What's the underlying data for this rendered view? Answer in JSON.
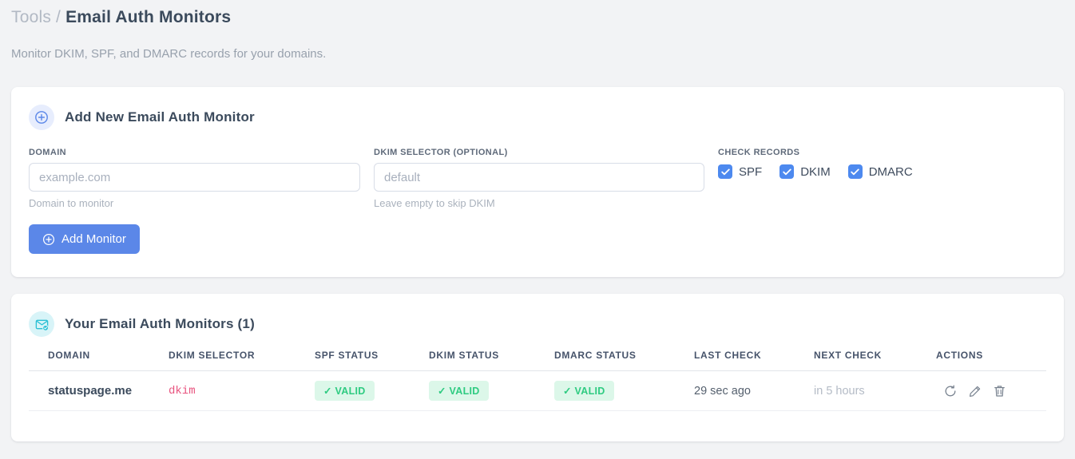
{
  "page": {
    "breadcrumb": {
      "section": "Tools",
      "separator": "/",
      "current": "Email Auth Monitors"
    },
    "subtitle": "Monitor DKIM, SPF, and DMARC records for your domains."
  },
  "add_monitor_card": {
    "title": "Add New Email Auth Monitor",
    "icon": "circle-plus-icon",
    "fields": {
      "domain": {
        "label": "DOMAIN",
        "placeholder": "example.com",
        "value": "",
        "helper": "Domain to monitor"
      },
      "dkim_selector": {
        "label": "DKIM SELECTOR (OPTIONAL)",
        "placeholder": "default",
        "value": "",
        "helper": "Leave empty to skip DKIM"
      }
    },
    "check_records": {
      "label": "CHECK RECORDS",
      "options": [
        {
          "label": "SPF",
          "checked": true
        },
        {
          "label": "DKIM",
          "checked": true
        },
        {
          "label": "DMARC",
          "checked": true
        }
      ]
    },
    "submit_label": "Add Monitor"
  },
  "monitors_card": {
    "title": "Your Email Auth Monitors (1)",
    "icon": "mail-check-icon",
    "table": {
      "columns": [
        "DOMAIN",
        "DKIM SELECTOR",
        "SPF STATUS",
        "DKIM STATUS",
        "DMARC STATUS",
        "LAST CHECK",
        "NEXT CHECK",
        "ACTIONS"
      ],
      "rows": [
        {
          "domain": "statuspage.me",
          "dkim_selector": "dkim",
          "spf_status": "✓ VALID",
          "dkim_status": "✓ VALID",
          "dmarc_status": "✓ VALID",
          "last_check": "29 sec ago",
          "next_check": "in 5 hours",
          "actions": [
            "refresh-icon",
            "edit-icon",
            "delete-icon"
          ]
        }
      ]
    }
  },
  "colors": {
    "accent_blue": "#5b87e8",
    "checkbox_blue": "#4d89ef",
    "teal": "#2bc0d4",
    "badge_green_bg": "#dcf7e9",
    "badge_green_text": "#2ecb81",
    "selector_pink": "#e8547f",
    "page_bg": "#f2f3f5"
  }
}
